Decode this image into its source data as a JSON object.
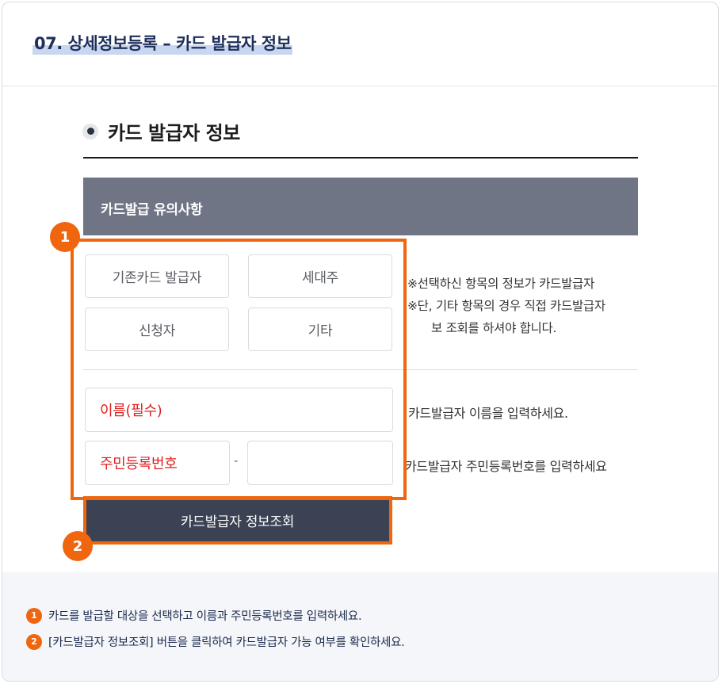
{
  "page_title": "07. 상세정보등록 – 카드 발급자 정보",
  "section": {
    "title": "카드 발급자 정보",
    "notice_title": "카드발급 유의사항"
  },
  "options": [
    "기존카드 발급자",
    "세대주",
    "신청자",
    "기타"
  ],
  "notes": [
    "※선택하신 항목의 정보가 카드발급자",
    "※단, 기타 항목의 경우 직접 카드발급자",
    "보 조회를 하셔야 합니다."
  ],
  "form": {
    "name_label": "이름(필수)",
    "name_hint": "카드발급자 이름을 입력하세요.",
    "rrn_label": "주민등록번호",
    "rrn_separator": "-",
    "rrn_hint": "카드발급자 주민등록번호를 입력하세요"
  },
  "search_button": "카드발급자 정보조회",
  "markers": [
    "1",
    "2"
  ],
  "guide": [
    {
      "num": "1",
      "text": "카드를 발급할 대상을 선택하고 이름과 주민등록번호를 입력하세요."
    },
    {
      "num": "2",
      "text": "[카드발급자 정보조회] 버튼을 클릭하여 카드발급자 가능 여부를 확인하세요."
    }
  ],
  "colors": {
    "accent": "#f0660f",
    "title": "#1f2f5c",
    "notice_bar": "#6f7585",
    "button": "#3a4253",
    "required": "#e02020"
  }
}
